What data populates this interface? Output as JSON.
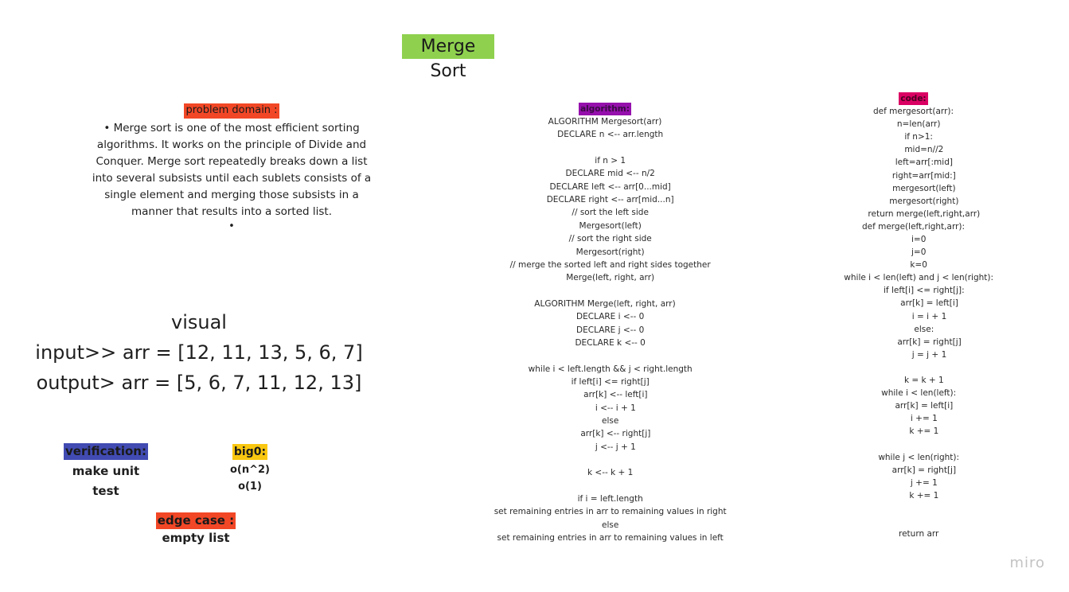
{
  "title": "Merge Sort",
  "problem": {
    "heading": "problem domain :",
    "bullet_text": "•  Merge sort is one of the most efficient sorting algorithms. It works on the principle of Divide and Conquer. Merge sort repeatedly breaks down a list into several subsists until each sublets consists of a single element and merging those subsists in a manner that results into a sorted list.",
    "empty_bullet": "•"
  },
  "visual": {
    "label": "visual",
    "input": "input>>  arr = [12, 11, 13, 5, 6, 7]",
    "output": "output> arr = [5, 6, 7, 11, 12, 13]"
  },
  "verification": {
    "heading": "verification:",
    "body": "make unit test"
  },
  "bigo": {
    "heading": "big0:",
    "line1": "o(n^2)",
    "line2": "o(1)"
  },
  "edge_case": {
    "heading": "edge case :",
    "body": "empty list"
  },
  "algorithm": {
    "heading": "algorithm:",
    "lines": [
      "ALGORITHM Mergesort(arr)",
      "    DECLARE n <-- arr.length",
      "",
      "    if n > 1",
      "    DECLARE mid <-- n/2",
      "    DECLARE left <-- arr[0...mid]",
      "    DECLARE right <-- arr[mid...n]",
      "    // sort the left side",
      "    Mergesort(left)",
      "    // sort the right side",
      "    Mergesort(right)",
      "    // merge the sorted left and right sides together",
      "    Merge(left, right, arr)",
      "",
      "ALGORITHM Merge(left, right, arr)",
      "    DECLARE i <-- 0",
      "    DECLARE j <-- 0",
      "    DECLARE k <-- 0",
      "",
      "    while i < left.length && j < right.length",
      "    if left[i] <= right[j]",
      "        arr[k] <-- left[i]",
      "        i <-- i + 1",
      "    else",
      "        arr[k] <-- right[j]",
      "        j <-- j + 1",
      "",
      "    k <-- k + 1",
      "",
      "    if i = left.length",
      "    set remaining entries in arr to remaining values in right",
      "    else",
      "    set remaining entries in arr to remaining values in left"
    ]
  },
  "code": {
    "heading": "code:",
    "lines": [
      "def mergesort(arr):",
      "    n=len(arr)",
      "    if n>1:",
      "        mid=n//2",
      "        left=arr[:mid]",
      "        right=arr[mid:]",
      "        mergesort(left)",
      "        mergesort(right)",
      "        return merge(left,right,arr)",
      "def merge(left,right,arr):",
      "    i=0",
      "    j=0",
      "    k=0",
      "    while i < len(left) and j < len(right):",
      "        if left[i] <= right[j]:",
      "            arr[k] = left[i]",
      "            i = i + 1",
      "        else:",
      "            arr[k] = right[j]",
      "            j = j + 1",
      "",
      "        k = k + 1",
      "    while i < len(left):",
      "        arr[k] = left[i]",
      "        i += 1",
      "        k += 1",
      "",
      "    while j < len(right):",
      "        arr[k] = right[j]",
      "        j += 1",
      "        k += 1",
      "",
      "",
      "    return arr"
    ]
  },
  "watermark": "miro",
  "colors": {
    "title_bg": "#8fd14f",
    "problem_bg": "#f24726",
    "verification_bg": "#414bb2",
    "bigo_bg": "#fac710",
    "edge_bg": "#f24726",
    "algorithm_bg": "#9510ac",
    "code_bg": "#da0063"
  }
}
